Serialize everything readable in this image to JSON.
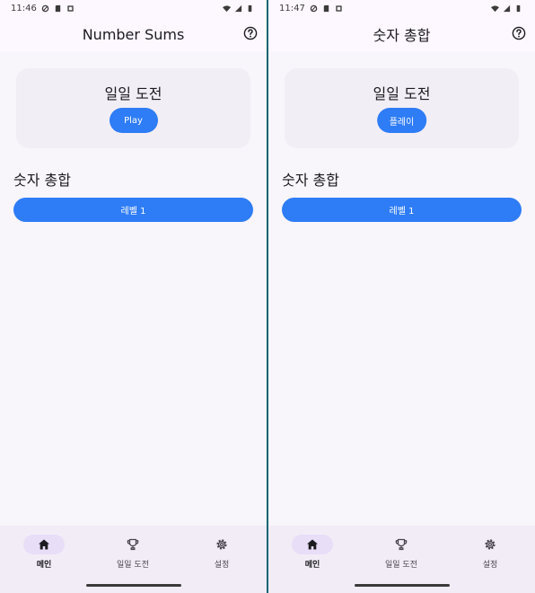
{
  "screens": [
    {
      "status": {
        "time": "11:46"
      },
      "title": "Number Sums",
      "daily": {
        "title": "일일 도전",
        "button": "Play"
      },
      "section": "숫자 총합",
      "level_button": "레벨 1",
      "nav": [
        {
          "label": "메인",
          "icon": "home-icon",
          "active": true
        },
        {
          "label": "일일 도전",
          "icon": "trophy-icon",
          "active": false
        },
        {
          "label": "설정",
          "icon": "gear-icon",
          "active": false
        }
      ]
    },
    {
      "status": {
        "time": "11:47"
      },
      "title": "숫자 총합",
      "daily": {
        "title": "일일 도전",
        "button": "플레이"
      },
      "section": "숫자 총합",
      "level_button": "레벨 1",
      "nav": [
        {
          "label": "메인",
          "icon": "home-icon",
          "active": true
        },
        {
          "label": "일일 도전",
          "icon": "trophy-icon",
          "active": false
        },
        {
          "label": "설정",
          "icon": "gear-icon",
          "active": false
        }
      ]
    }
  ],
  "colors": {
    "primary": "#2e7cf6",
    "surface": "#f8f5fb",
    "card": "#f2eef5",
    "nav_indicator": "#e8def8",
    "divider": "#0b6670"
  }
}
